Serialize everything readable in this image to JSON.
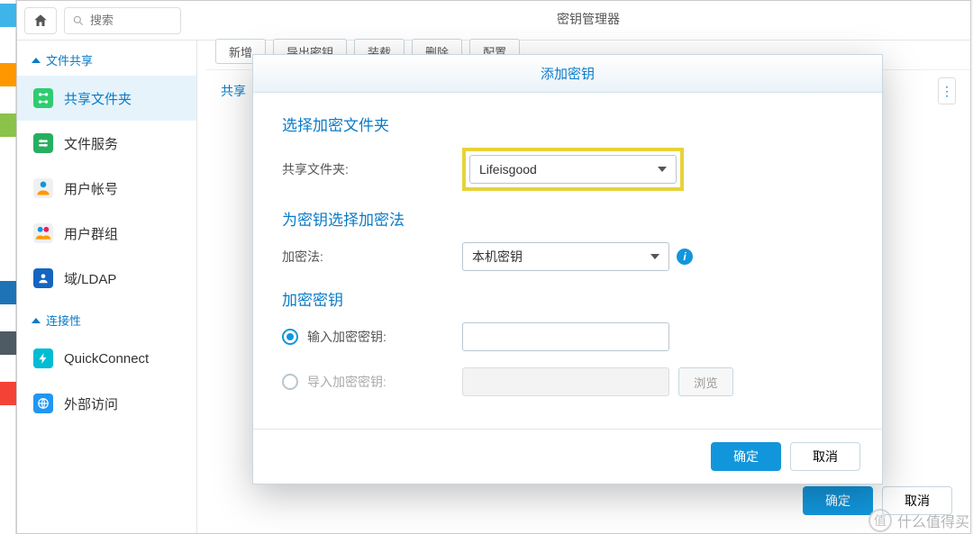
{
  "search": {
    "placeholder": "搜索"
  },
  "leftnav": {
    "group_share": "文件共享",
    "group_conn": "连接性",
    "items": {
      "shared_folder": "共享文件夹",
      "file_service": "文件服务",
      "user_account": "用户帐号",
      "user_group": "用户群组",
      "domain_ldap": "域/LDAP",
      "quickconnect": "QuickConnect",
      "external_access": "外部访问"
    }
  },
  "bg_window": {
    "title": "密钥管理器",
    "toolbar": {
      "add": "新增",
      "export": "导出密钥",
      "mount": "装载",
      "delete": "删除",
      "config": "配置"
    },
    "subtab": "共享",
    "ok": "确定",
    "cancel": "取消"
  },
  "modal": {
    "title": "添加密钥",
    "section_folder": "选择加密文件夹",
    "label_folder": "共享文件夹:",
    "folder_value": "Lifeisgood",
    "section_method": "为密钥选择加密法",
    "label_method": "加密法:",
    "method_value": "本机密钥",
    "section_key": "加密密钥",
    "radio_input": "输入加密密钥:",
    "radio_import": "导入加密密钥:",
    "browse": "浏览",
    "ok": "确定",
    "cancel": "取消"
  },
  "watermark": "什么值得买"
}
